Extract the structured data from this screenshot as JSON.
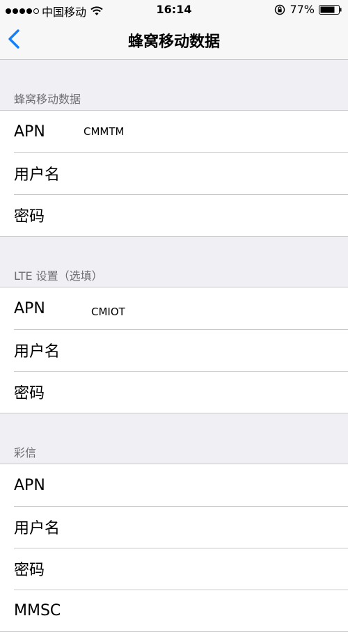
{
  "status_bar": {
    "carrier": "中国移动",
    "time": "16:14",
    "battery": "77%"
  },
  "nav": {
    "back_icon": "chevron-left-icon",
    "title": "蜂窝移动数据"
  },
  "sections": [
    {
      "header": "蜂窝移动数据",
      "rows": [
        {
          "label": "APN",
          "value": "CMMTM"
        },
        {
          "label": "用户名",
          "value": ""
        },
        {
          "label": "密码",
          "value": ""
        }
      ]
    },
    {
      "header": "LTE 设置（选填）",
      "rows": [
        {
          "label": "APN",
          "value": "CMIOT"
        },
        {
          "label": "用户名",
          "value": ""
        },
        {
          "label": "密码",
          "value": ""
        }
      ]
    },
    {
      "header": "彩信",
      "rows": [
        {
          "label": "APN",
          "value": ""
        },
        {
          "label": "用户名",
          "value": ""
        },
        {
          "label": "密码",
          "value": ""
        },
        {
          "label": "MMSC",
          "value": ""
        }
      ]
    }
  ],
  "colors": {
    "accent": "#157efb",
    "background": "#efeff4",
    "separator": "#c8c7cc",
    "header_text": "#6d6d72"
  }
}
